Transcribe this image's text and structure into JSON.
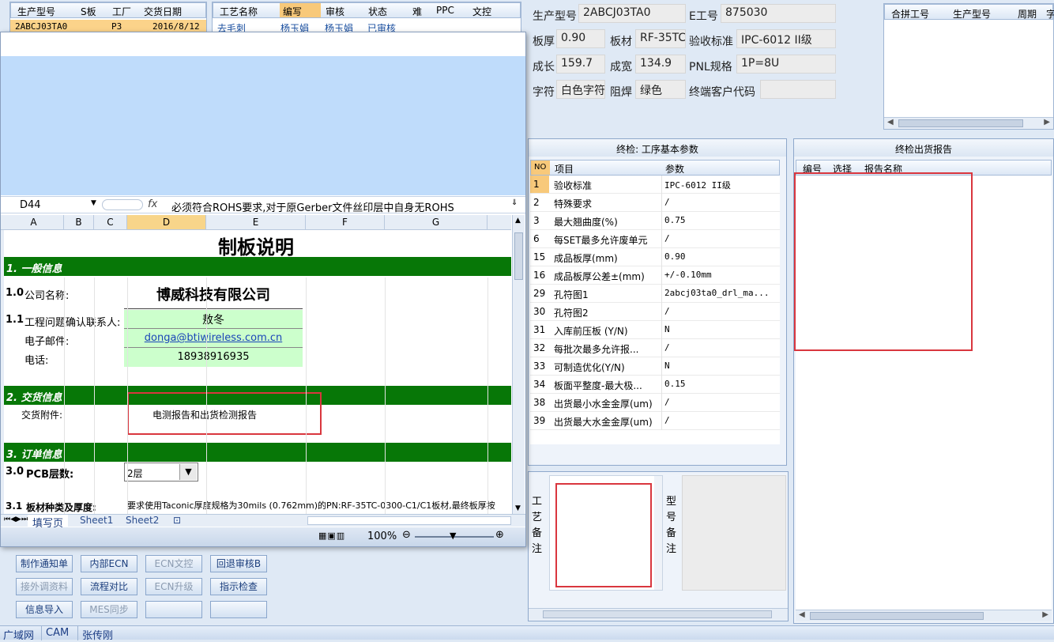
{
  "top_left_grid": {
    "headers": [
      "生产型号",
      "S板",
      "工厂",
      "交货日期"
    ],
    "row": [
      "2ABCJ03TA0",
      "P3",
      "2016/8/12"
    ]
  },
  "process_grid": {
    "headers": [
      "工艺名称",
      "编写",
      "审核",
      "状态",
      "难",
      "PPC",
      "文控"
    ],
    "row": [
      "去毛刺",
      "杨玉娟",
      "杨玉娟",
      "已审核"
    ]
  },
  "product_info": {
    "model_label": "生产型号",
    "model": "2ABCJ03TA0",
    "eno_label": "E工号",
    "eno": "875030",
    "thickness_label": "板厚",
    "thickness": "0.90",
    "material_label": "板材",
    "material": "RF-35TC",
    "standard_label": "验收标准",
    "standard": "IPC-6012 II级",
    "length_label": "成长",
    "length": "159.7",
    "width_label": "成宽",
    "width": "134.9",
    "pnl_label": "PNL规格",
    "pnl": "1P=8U",
    "char_label": "字符",
    "char": "白色字符",
    "mask_label": "阻焊",
    "mask": "绿色",
    "customer_label": "终端客户代码",
    "customer": ""
  },
  "merge_grid": {
    "headers": [
      "合拼工号",
      "生产型号",
      "周期",
      "字"
    ]
  },
  "final_params": {
    "title": "终检: 工序基本参数",
    "headers": [
      "NO",
      "项目",
      "参数"
    ],
    "rows": [
      {
        "no": "1",
        "item": "验收标准",
        "value": "IPC-6012 II级"
      },
      {
        "no": "2",
        "item": "特殊要求",
        "value": "/"
      },
      {
        "no": "3",
        "item": "最大翘曲度(%)",
        "value": "0.75"
      },
      {
        "no": "6",
        "item": "每SET最多允许废单元",
        "value": "/"
      },
      {
        "no": "15",
        "item": "成品板厚(mm)",
        "value": "0.90"
      },
      {
        "no": "16",
        "item": "成品板厚公差±(mm)",
        "value": "+/-0.10mm"
      },
      {
        "no": "29",
        "item": "孔符图1",
        "value": "2abcj03ta0_drl_ma..."
      },
      {
        "no": "30",
        "item": "孔符图2",
        "value": "/"
      },
      {
        "no": "31",
        "item": "入库前压板 (Y/N)",
        "value": "N"
      },
      {
        "no": "32",
        "item": "每批次最多允许报...",
        "value": "/"
      },
      {
        "no": "33",
        "item": "可制造优化(Y/N)",
        "value": "N"
      },
      {
        "no": "34",
        "item": "板面平整度-最大极...",
        "value": "0.15"
      },
      {
        "no": "38",
        "item": "出货最小水金金厚(um)",
        "value": "/"
      },
      {
        "no": "39",
        "item": "出货最大水金金厚(um)",
        "value": "/"
      }
    ]
  },
  "report_panel": {
    "title": "终检出货报告",
    "headers": [
      "编号",
      "选择",
      "报告名称"
    ]
  },
  "notes": {
    "process_label": "工\n艺\n备\n注",
    "model_label": "型\n号\n备\n注"
  },
  "excel": {
    "cell_ref": "D44",
    "fx": "fx",
    "formula": "必须符合ROHS要求,对于原Gerber文件丝印层中自身无ROHS",
    "columns": [
      "A",
      "B",
      "C",
      "D",
      "E",
      "F",
      "G"
    ],
    "title": "制板说明",
    "sec1": "1. 一般信息",
    "r10_num": "1.0",
    "r10_label": "公司名称:",
    "company": "博威科技有限公司",
    "r11_num": "1.1",
    "r11_label": "工程问题确认联系人:",
    "contact": "敖冬",
    "email_label": "电子邮件:",
    "email": "donga@btiwireless.com.cn",
    "phone_label": "电话:",
    "phone": "18938916935",
    "sec2": "2. 交货信息",
    "attach_label": "交货附件:",
    "attach": "电测报告和出货检测报告",
    "sec3": "3. 订单信息",
    "r30_num": "3.0",
    "r30_label": "PCB层数:",
    "layers": "2层",
    "r31_num": "3.1",
    "r31_label": "板材种类及厚度:",
    "r31_value": "要求使用Taconic厚度规格为30mils (0.762mm)的PN:RF-35TC-0300-C1/C1板材,最终板厚按",
    "sheets": [
      "填写页",
      "Sheet1",
      "Sheet2"
    ],
    "zoom": "100%"
  },
  "buttons": [
    [
      "制作通知单",
      "内部ECN",
      "ECN文控",
      "回退审核B"
    ],
    [
      "接外调资料",
      "流程对比",
      "ECN升级",
      "指示检查"
    ],
    [
      "信息导入",
      "MES同步",
      "",
      ""
    ]
  ],
  "buttons_disabled": [
    [
      false,
      false,
      true,
      false
    ],
    [
      true,
      false,
      true,
      false
    ],
    [
      false,
      true,
      false,
      false
    ]
  ],
  "status_bar": [
    "广域网",
    "CAM",
    "张传刚"
  ],
  "colors": {
    "section_green": "#077707",
    "highlight_red": "#d9363e",
    "field_green": "#ccffcc",
    "excel_blue": "#bfdcfb"
  }
}
